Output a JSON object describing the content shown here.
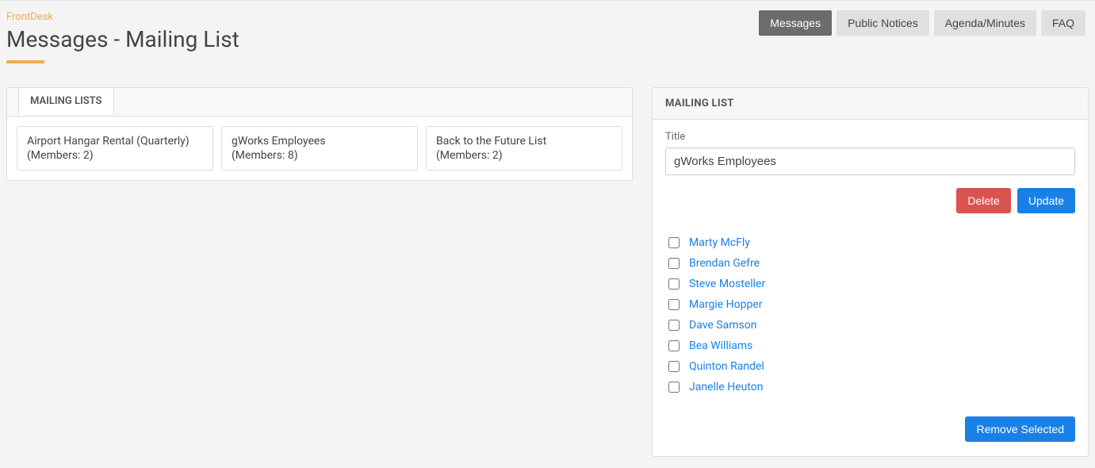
{
  "brand": "FrontDesk",
  "page_title": "Messages - Mailing List",
  "nav": {
    "messages": "Messages",
    "public_notices": "Public Notices",
    "agenda_minutes": "Agenda/Minutes",
    "faq": "FAQ"
  },
  "mailing_lists_tab": "MAILING LISTS",
  "lists": [
    {
      "name": "Airport Hangar Rental (Quarterly)",
      "members_label": "(Members: 2)"
    },
    {
      "name": "gWorks Employees",
      "members_label": "(Members: 8)"
    },
    {
      "name": "Back to the Future List",
      "members_label": "(Members: 2)"
    }
  ],
  "detail": {
    "header": "MAILING LIST",
    "title_label": "Title",
    "title_value": "gWorks Employees",
    "delete_label": "Delete",
    "update_label": "Update",
    "remove_label": "Remove Selected",
    "members": [
      "Marty McFly",
      "Brendan Gefre",
      "Steve Mosteller",
      "Margie Hopper",
      "Dave Samson",
      "Bea Williams",
      "Quinton Randel",
      "Janelle Heuton"
    ]
  }
}
